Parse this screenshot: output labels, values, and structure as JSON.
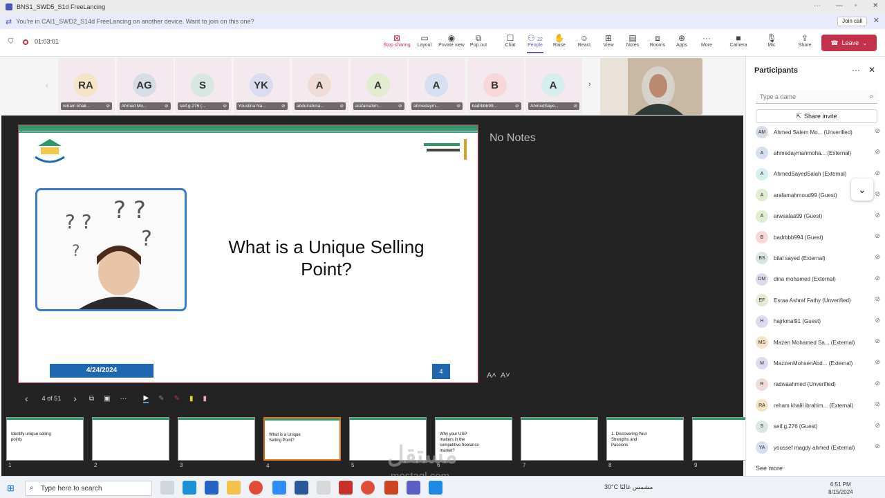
{
  "window": {
    "title": "BNS1_SWD5_S1d FreeLancing"
  },
  "banner": {
    "text": "You're in CAI1_SWD2_S14d FreeLancing on another device. Want to join on this one?",
    "join_label": "Join call"
  },
  "meeting": {
    "timer": "01:03:01"
  },
  "toolbar": {
    "stop_sharing": "Stop sharing",
    "layout": "Layout",
    "private_view": "Private view",
    "pop_out": "Pop out",
    "chat": "Chat",
    "people": "People",
    "people_count": "22",
    "raise": "Raise",
    "react": "React",
    "view": "View",
    "notes": "Notes",
    "rooms": "Rooms",
    "apps": "Apps",
    "more": "More",
    "camera": "Camera",
    "mic": "Mic",
    "share": "Share",
    "leave": "Leave"
  },
  "gallery": [
    {
      "initials": "RA",
      "name": "reham khali...",
      "color": "#f6e4c8"
    },
    {
      "initials": "AG",
      "name": "Ahmed Mo...",
      "color": "#d7dde6"
    },
    {
      "initials": "S",
      "name": "seif.g.276 (...",
      "color": "#d9e7e2"
    },
    {
      "initials": "YK",
      "name": "Youstina Na...",
      "color": "#dcdcf0"
    },
    {
      "initials": "A",
      "name": "abdulrahma...",
      "color": "#efdcd6"
    },
    {
      "initials": "A",
      "name": "arafamahm...",
      "color": "#e2ecd0"
    },
    {
      "initials": "A",
      "name": "ahmedaym...",
      "color": "#d6e0f0"
    },
    {
      "initials": "B",
      "name": "badrbbb99...",
      "color": "#f7d7d7"
    },
    {
      "initials": "A",
      "name": "AhmedSaye...",
      "color": "#d6eeee"
    }
  ],
  "slide": {
    "title": "What is a Unique Selling Point?",
    "date": "4/24/2024",
    "number": "4"
  },
  "notes": {
    "text": "No Notes"
  },
  "presenter": {
    "counter": "4 of 51"
  },
  "thumbnails": [
    {
      "n": "1",
      "title": "Identify unique selling points"
    },
    {
      "n": "2",
      "title": ""
    },
    {
      "n": "3",
      "title": ""
    },
    {
      "n": "4",
      "title": "What is a Unique Selling Point?"
    },
    {
      "n": "5",
      "title": ""
    },
    {
      "n": "6",
      "title": "Why your USP matters in the competitive freelance market?"
    },
    {
      "n": "7",
      "title": ""
    },
    {
      "n": "8",
      "title": "1. Discovering Your Strengths and Passions"
    },
    {
      "n": "9",
      "title": ""
    }
  ],
  "participants": {
    "title": "Participants",
    "search_placeholder": "Type a name",
    "share_invite": "Share invite",
    "see_more": "See more",
    "list": [
      {
        "initials": "AM",
        "name": "Ahmed Salem Mo... (Unverified)",
        "color": "#d7dde6"
      },
      {
        "initials": "A",
        "name": "ahmedaymanmoha... (External)",
        "color": "#d6e0f0"
      },
      {
        "initials": "A",
        "name": "AhmedSayedSalah (External)",
        "color": "#d6eeee"
      },
      {
        "initials": "A",
        "name": "arafamahmoud99 (Guest)",
        "color": "#e2ecd0"
      },
      {
        "initials": "A",
        "name": "arwaalaa99 (Guest)",
        "color": "#e2ecd0"
      },
      {
        "initials": "B",
        "name": "badrbbb994 (Guest)",
        "color": "#f7d7d7"
      },
      {
        "initials": "BS",
        "name": "bilal sayed (External)",
        "color": "#d9e7e2"
      },
      {
        "initials": "DM",
        "name": "dina mohamed (External)",
        "color": "#dcdcf0"
      },
      {
        "initials": "EF",
        "name": "Esraa Ashraf Fathy (Unverified)",
        "color": "#e2ecd0"
      },
      {
        "initials": "H",
        "name": "hajrkmal91 (Guest)",
        "color": "#dcdcf0"
      },
      {
        "initials": "MS",
        "name": "Mazen Mohamed Sa... (External)",
        "color": "#f6e4c8"
      },
      {
        "initials": "M",
        "name": "MazzenMohsenAbd... (External)",
        "color": "#dcdcf0"
      },
      {
        "initials": "R",
        "name": "radwaahmed (Unverified)",
        "color": "#efdcd6"
      },
      {
        "initials": "RA",
        "name": "reham khalil ibrahim... (External)",
        "color": "#f6e4c8"
      },
      {
        "initials": "S",
        "name": "seif.g.276 (Guest)",
        "color": "#d9e7e2"
      },
      {
        "initials": "YA",
        "name": "youssef magdy ahmed (External)",
        "color": "#d6e0f0"
      }
    ]
  },
  "taskbar": {
    "search": "Type here to search",
    "weather": "30°C  مشمس غالبًا",
    "time": "6:51 PM",
    "date": "8/15/2024"
  },
  "watermark": {
    "ar": "مستقل",
    "en": "mostaql.com"
  }
}
